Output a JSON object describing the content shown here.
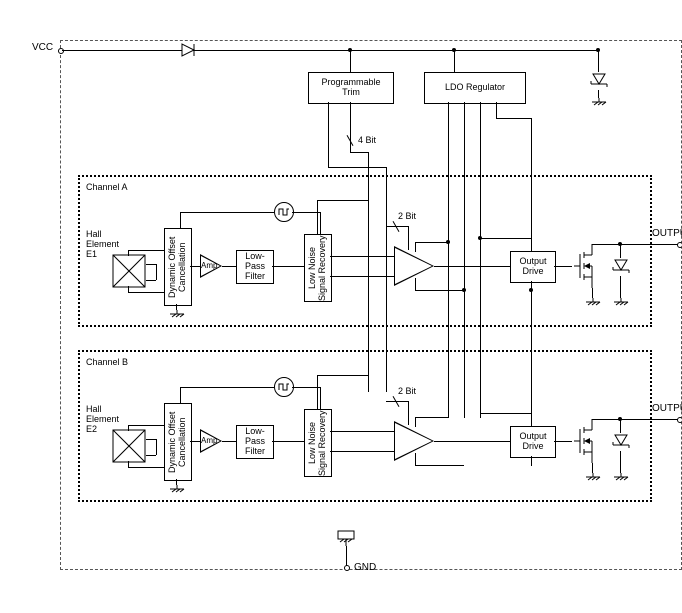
{
  "pins": {
    "vcc": "VCC",
    "outputa": "OUTPUTA",
    "outputb": "OUTPUTB",
    "gnd": "GND"
  },
  "top_blocks": {
    "prog_trim": "Programmable\nTrim",
    "ldo": "LDO Regulator",
    "bus_4bit": "4 Bit"
  },
  "channel_a": {
    "title": "Channel A",
    "hall_label": "Hall\nElement\nE1",
    "doc": "Dynamic Offset\nCancellation",
    "amp": "Amp",
    "lpf": "Low-\nPass\nFilter",
    "recovery": "Low Noise Signal\nRecovery",
    "bus_2bit": "2 Bit",
    "output_drive": "Output\nDrive"
  },
  "channel_b": {
    "title": "Channel B",
    "hall_label": "Hall\nElement\nE2",
    "doc": "Dynamic Offset\nCancellation",
    "amp": "Amp",
    "lpf": "Low-\nPass\nFilter",
    "recovery": "Low Noise Signal\nRecovery",
    "bus_2bit": "2 Bit",
    "output_drive": "Output\nDrive"
  }
}
